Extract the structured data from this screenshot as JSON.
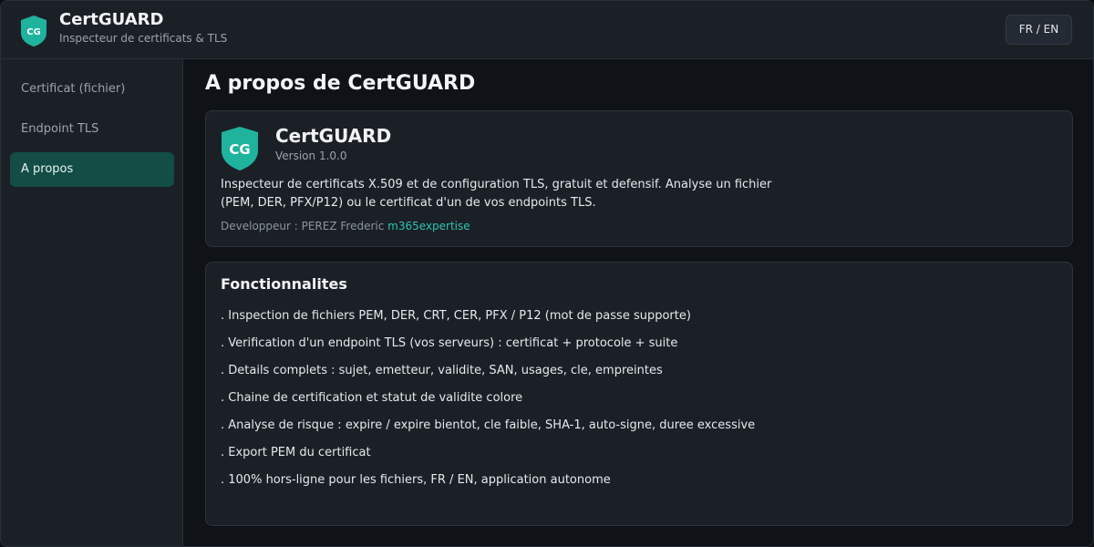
{
  "header": {
    "logo_text": "CG",
    "title": "CertGUARD",
    "subtitle": "Inspecteur de certificats & TLS",
    "lang_button": "FR / EN"
  },
  "sidebar": {
    "items": [
      {
        "label": "Certificat (fichier)",
        "active": false
      },
      {
        "label": "Endpoint TLS",
        "active": false
      },
      {
        "label": "A propos",
        "active": true
      }
    ]
  },
  "main": {
    "title": "A propos de CertGUARD",
    "about": {
      "logo_text": "CG",
      "name": "CertGUARD",
      "version": "Version 1.0.0",
      "description": "Inspecteur de certificats X.509 et de configuration TLS, gratuit et defensif. Analyse un fichier (PEM, DER, PFX/P12) ou le certificat d'un de vos endpoints TLS.",
      "developer_label": "Developpeur : PEREZ Frederic",
      "developer_link": "m365expertise"
    },
    "features": {
      "title": "Fonctionnalites",
      "items": [
        ". Inspection de fichiers PEM, DER, CRT, CER, PFX / P12 (mot de passe supporte)",
        ". Verification d'un endpoint TLS (vos serveurs) : certificat + protocole + suite",
        ". Details complets : sujet, emetteur, validite, SAN, usages, cle, empreintes",
        ". Chaine de certification et statut de validite colore",
        ". Analyse de risque : expire / expire bientot, cle faible, SHA-1, auto-signe, duree excessive",
        ". Export PEM du certificat",
        ". 100% hors-ligne pour les fichiers, FR / EN, application autonome"
      ]
    }
  },
  "colors": {
    "accent": "#2ec4b0",
    "shield": "#1fb39e",
    "active_nav": "#134d45",
    "background": "#0f1317",
    "panel": "#1b2027"
  }
}
